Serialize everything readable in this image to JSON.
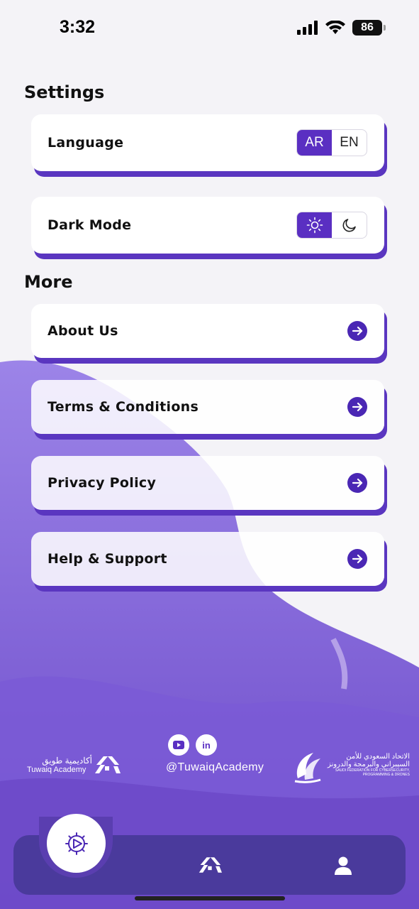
{
  "status_bar": {
    "time": "3:32",
    "battery": "86"
  },
  "settings": {
    "title": "Settings",
    "language": {
      "label": "Language",
      "options": [
        "AR",
        "EN"
      ],
      "selected": "AR"
    },
    "dark_mode": {
      "label": "Dark Mode",
      "options": [
        "light-icon",
        "dark-icon"
      ],
      "selected": "light"
    }
  },
  "more": {
    "title": "More",
    "items": [
      {
        "label": "About Us"
      },
      {
        "label": "Terms & Conditions"
      },
      {
        "label": "Privacy Policy"
      },
      {
        "label": "Help & Support"
      }
    ]
  },
  "footer": {
    "social_handle": "@TuwaiqAcademy",
    "tuwaiq_arabic": "أكاديمية طويق",
    "tuwaiq_english": "Tuwaiq Academy",
    "federation_arabic_1": "الاتحاد السعودي للأمن",
    "federation_arabic_2": "السيبراني والبرمجة والدرونز",
    "federation_english_1": "SAUDI FEDERATION FOR CYBERSECURITY,",
    "federation_english_2": "PROGRAMMING & DRONES"
  },
  "tabs": [
    {
      "name": "settings",
      "icon": "gear-icon"
    },
    {
      "name": "home",
      "icon": "tuwaiq-logo-icon"
    },
    {
      "name": "profile",
      "icon": "person-icon"
    }
  ],
  "colors": {
    "accent": "#5a2fc2",
    "card_shadow": "#5a36c0",
    "tab_bar": "#4a3a9c",
    "background": "#f4f3f7"
  }
}
